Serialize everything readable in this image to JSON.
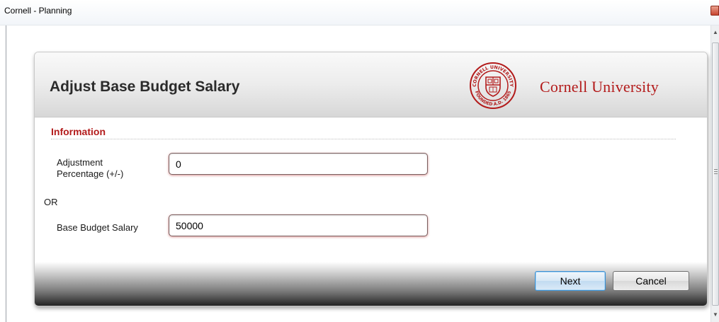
{
  "window": {
    "title": "Cornell - Planning"
  },
  "dialog": {
    "title": "Adjust Base Budget Salary",
    "brand_text": "Cornell University",
    "section_label": "Information",
    "fields": {
      "adjustment_label": "Adjustment Percentage (+/-)",
      "adjustment_value": "0",
      "or_text": "OR",
      "base_label": "Base Budget Salary",
      "base_value": "50000"
    },
    "buttons": {
      "next": "Next",
      "cancel": "Cancel"
    },
    "seal": {
      "top_text": "CORNELL UNIVERSITY",
      "bottom_text": "FOUNDED A.D. 1865"
    }
  },
  "colors": {
    "brand_red": "#b31b1b",
    "focus_blue": "#3c8fd1"
  }
}
